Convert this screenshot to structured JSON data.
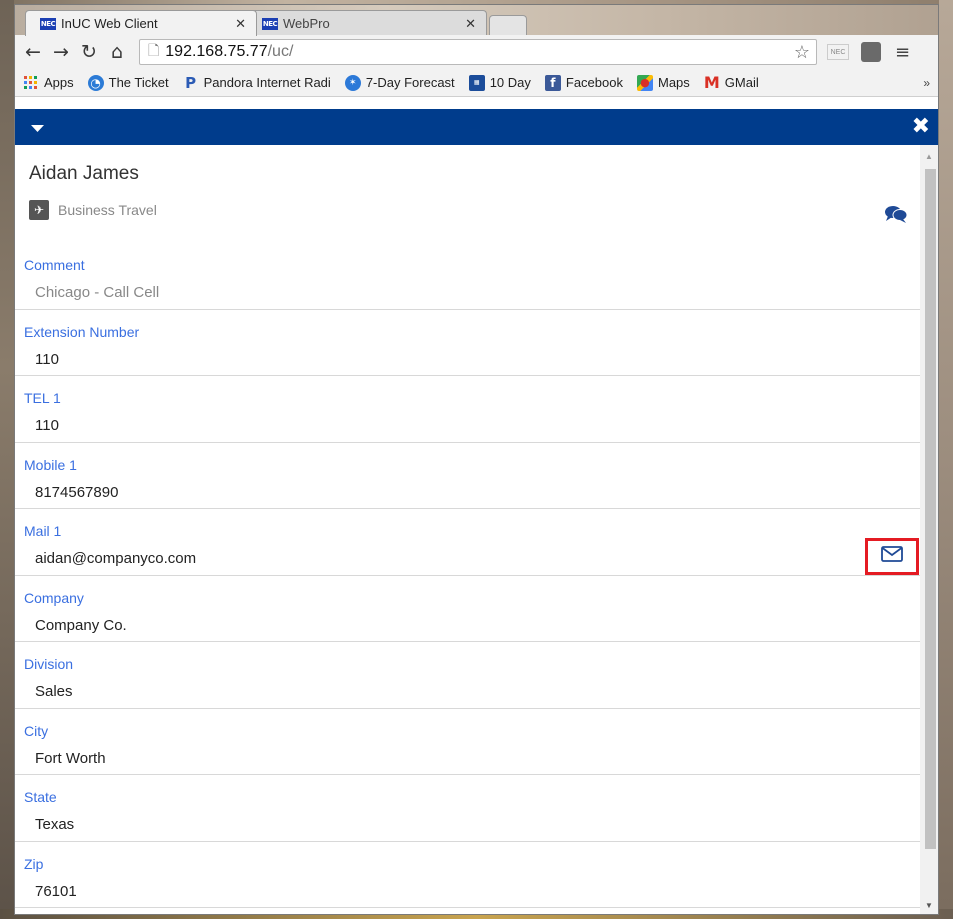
{
  "browser": {
    "tabs": [
      {
        "label": "InUC Web Client",
        "favicon": "NEC"
      },
      {
        "label": "WebPro",
        "favicon": "NEC"
      }
    ],
    "address": {
      "host": "192.168.75.77",
      "path": "/uc/"
    },
    "ext_label": "NEC",
    "bookmarks": [
      {
        "label": "Apps",
        "icon": "apps-grid-icon",
        "color": "#e0533a"
      },
      {
        "label": "The Ticket",
        "icon": "ticket-icon",
        "color": "#2c7bd6"
      },
      {
        "label": "Pandora Internet Radi",
        "icon": "pandora-icon",
        "color": "#2b5bb5"
      },
      {
        "label": "7-Day Forecast",
        "icon": "weather-icon",
        "color": "#2c79d8"
      },
      {
        "label": "10 Day",
        "icon": "weather-channel-icon",
        "color": "#1b4c9a"
      },
      {
        "label": "Facebook",
        "icon": "facebook-icon",
        "color": "#3b5998"
      },
      {
        "label": "Maps",
        "icon": "maps-icon",
        "color": "#34a853"
      },
      {
        "label": "GMail",
        "icon": "gmail-icon",
        "color": "#d93025"
      }
    ]
  },
  "app": {
    "header_color": "#003c8c",
    "contact": {
      "name": "Aidan James",
      "status": "Business Travel"
    },
    "fields": [
      {
        "label": "Comment",
        "value": "Chicago - Call Cell"
      },
      {
        "label": "Extension Number",
        "value": "110"
      },
      {
        "label": "TEL 1",
        "value": "110"
      },
      {
        "label": "Mobile 1",
        "value": "8174567890"
      },
      {
        "label": "Mail 1",
        "value": "aidan@companyco.com"
      },
      {
        "label": "Company",
        "value": "Company Co."
      },
      {
        "label": "Division",
        "value": "Sales"
      },
      {
        "label": "City",
        "value": "Fort Worth"
      },
      {
        "label": "State",
        "value": "Texas"
      },
      {
        "label": "Zip",
        "value": "76101"
      }
    ],
    "highlight_color": "#e41b23"
  }
}
